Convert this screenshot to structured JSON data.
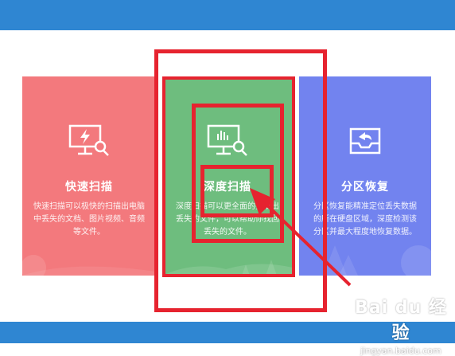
{
  "cards": [
    {
      "title": "快速扫描",
      "description": "快速扫描可以极快的扫描出电脑中丢失的文档、图片视频、音频等文件。",
      "icon": "monitor-lightning-search-icon",
      "color": "#f3797d"
    },
    {
      "title": "深度扫描",
      "description": "深度扫描可以更全面的扫描出丢失的文件，可以帮助你找回丢失的文件。",
      "icon": "monitor-chart-search-icon",
      "color": "#6ebd7e"
    },
    {
      "title": "分区恢复",
      "description": "分区恢复能精准定位丢失数据的所在硬盘区域，深度检测该分区并最大程度地恢复数据。",
      "icon": "tray-return-icon",
      "color": "#7283ef"
    }
  ],
  "annotation": {
    "color": "#e6232f"
  },
  "watermark": {
    "logo": "Bai du 经验",
    "url": "jingyan.baidu.com"
  },
  "theme": {
    "bar_color": "#2f86d2"
  }
}
